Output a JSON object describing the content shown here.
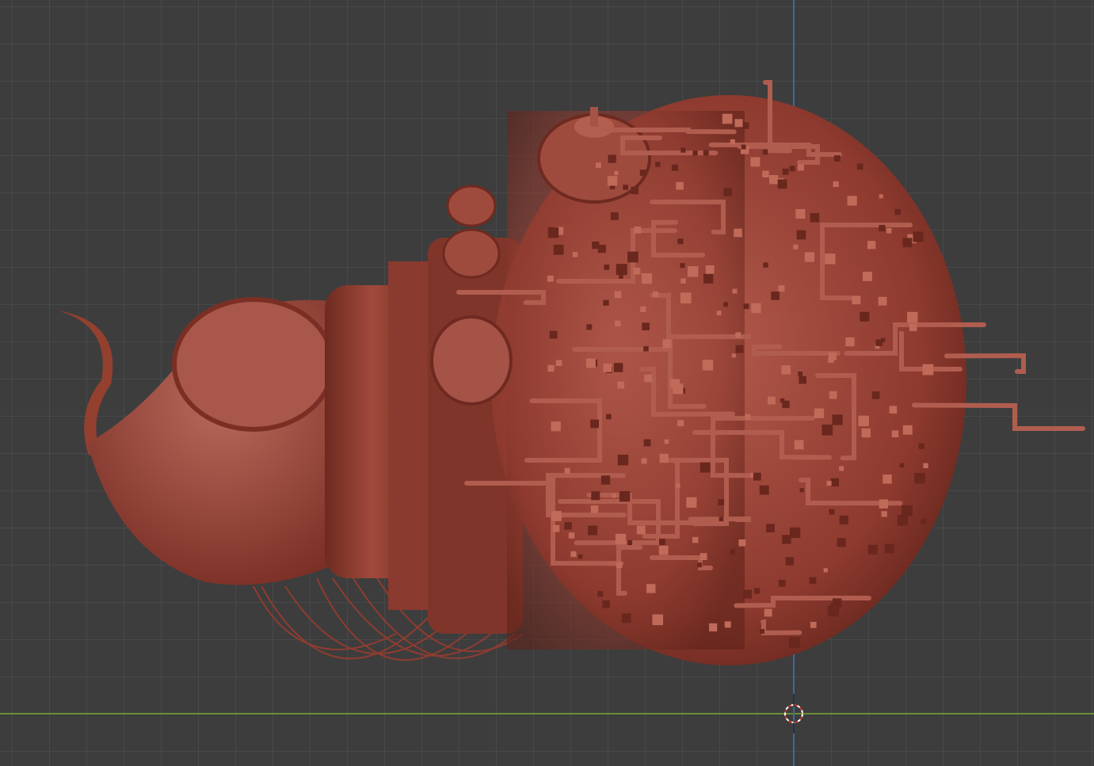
{
  "viewport": {
    "background_color": "#3d3d3d",
    "grid_color": "#494949",
    "x_axis_color": "#6a8f32",
    "z_axis_color": "#3f6a9c",
    "model_color": "#a0483c",
    "cursor": "3d-cursor-icon"
  }
}
